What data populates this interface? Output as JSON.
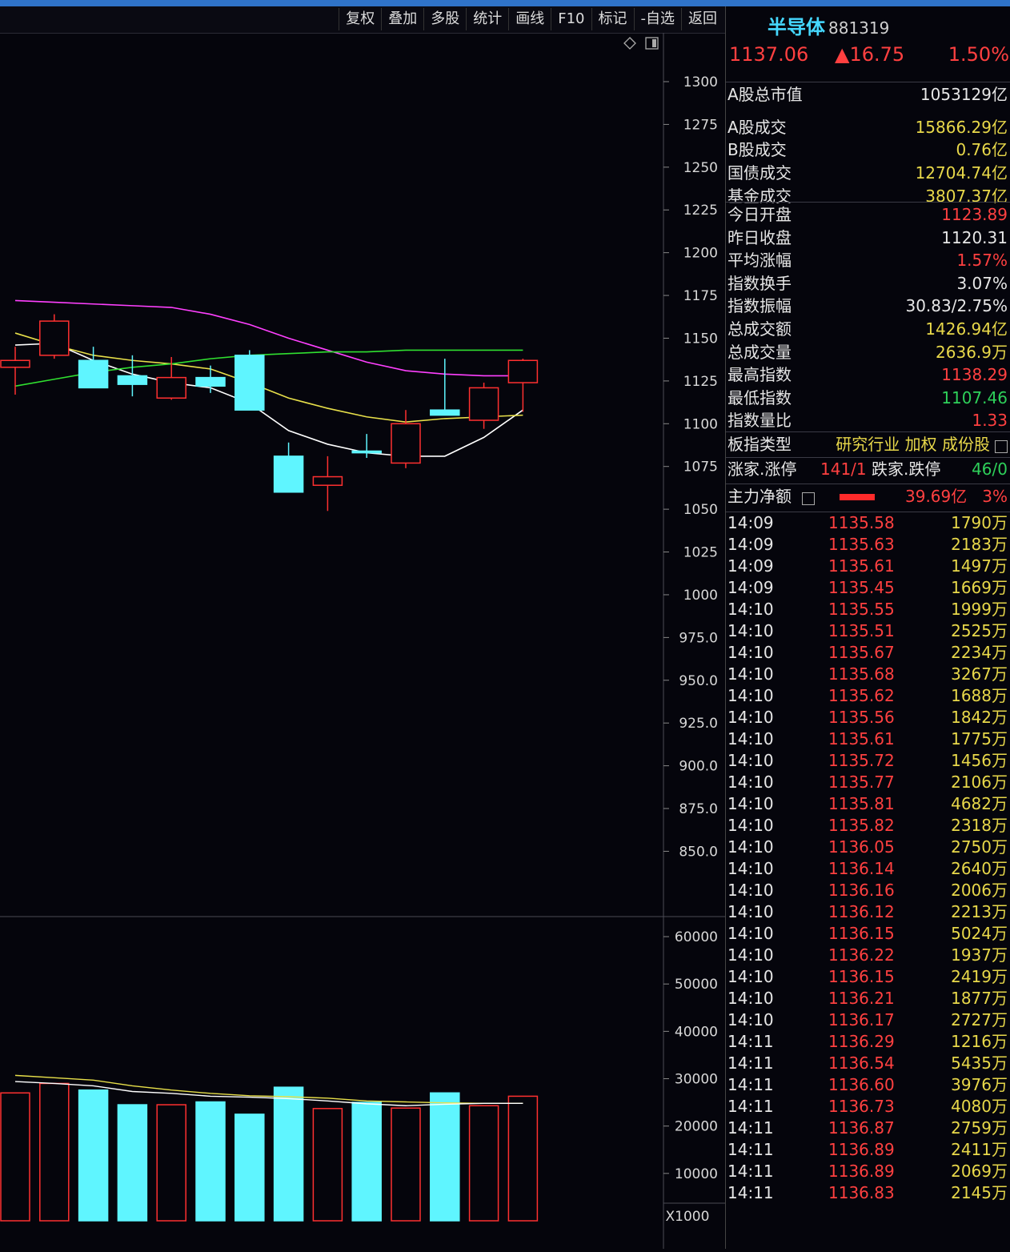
{
  "toolbar": {
    "items": [
      "复权",
      "叠加",
      "多股",
      "统计",
      "画线",
      "F10",
      "标记",
      "-自选",
      "返回"
    ]
  },
  "header": {
    "name": "半导体",
    "code": "881319",
    "price": "1137.06",
    "change": "▲16.75",
    "change_pct": "1.50%"
  },
  "market": [
    {
      "label": "A股总市值",
      "value": "1053129亿",
      "color": "#e6e6e6"
    },
    {
      "label": "A股成交",
      "value": "15866.29亿",
      "color": "#e8d84a"
    },
    {
      "label": "B股成交",
      "value": "0.76亿",
      "color": "#e8d84a"
    },
    {
      "label": "国债成交",
      "value": "12704.74亿",
      "color": "#e8d84a"
    },
    {
      "label": "基金成交",
      "value": "3807.37亿",
      "color": "#e8d84a"
    }
  ],
  "stats": [
    {
      "label": "今日开盘",
      "value": "1123.89",
      "color": "#ff4040"
    },
    {
      "label": "昨日收盘",
      "value": "1120.31",
      "color": "#e6e6e6"
    },
    {
      "label": "平均涨幅",
      "value": "1.57%",
      "color": "#ff4040"
    },
    {
      "label": "指数换手",
      "value": "3.07%",
      "color": "#e6e6e6"
    },
    {
      "label": "指数振幅",
      "value": "30.83/2.75%",
      "color": "#e6e6e6"
    },
    {
      "label": "总成交额",
      "value": "1426.94亿",
      "color": "#e8d84a"
    },
    {
      "label": "总成交量",
      "value": "2636.9万",
      "color": "#e8d84a"
    },
    {
      "label": "最高指数",
      "value": "1138.29",
      "color": "#ff4040"
    },
    {
      "label": "最低指数",
      "value": "1107.46",
      "color": "#2ed05a"
    },
    {
      "label": "指数量比",
      "value": "1.33",
      "color": "#ff4040"
    }
  ],
  "board": {
    "label": "板指类型",
    "value": "研究行业 加权 成份股"
  },
  "updown": {
    "up_label": "涨家.涨停",
    "up_value": "141/1",
    "down_label": "跌家.跌停",
    "down_value": "46/0"
  },
  "mainforce": {
    "label": "主力净额",
    "value": "39.69亿",
    "pct": "3%"
  },
  "ticks": [
    {
      "t": "14:09",
      "p": "1135.58",
      "v": "1790万"
    },
    {
      "t": "14:09",
      "p": "1135.63",
      "v": "2183万"
    },
    {
      "t": "14:09",
      "p": "1135.61",
      "v": "1497万"
    },
    {
      "t": "14:09",
      "p": "1135.45",
      "v": "1669万"
    },
    {
      "t": "14:10",
      "p": "1135.55",
      "v": "1999万"
    },
    {
      "t": "14:10",
      "p": "1135.51",
      "v": "2525万"
    },
    {
      "t": "14:10",
      "p": "1135.67",
      "v": "2234万"
    },
    {
      "t": "14:10",
      "p": "1135.68",
      "v": "3267万"
    },
    {
      "t": "14:10",
      "p": "1135.62",
      "v": "1688万"
    },
    {
      "t": "14:10",
      "p": "1135.56",
      "v": "1842万"
    },
    {
      "t": "14:10",
      "p": "1135.61",
      "v": "1775万"
    },
    {
      "t": "14:10",
      "p": "1135.72",
      "v": "1456万"
    },
    {
      "t": "14:10",
      "p": "1135.77",
      "v": "2106万"
    },
    {
      "t": "14:10",
      "p": "1135.81",
      "v": "4682万"
    },
    {
      "t": "14:10",
      "p": "1135.82",
      "v": "2318万"
    },
    {
      "t": "14:10",
      "p": "1136.05",
      "v": "2750万"
    },
    {
      "t": "14:10",
      "p": "1136.14",
      "v": "2640万"
    },
    {
      "t": "14:10",
      "p": "1136.16",
      "v": "2006万"
    },
    {
      "t": "14:10",
      "p": "1136.12",
      "v": "2213万"
    },
    {
      "t": "14:10",
      "p": "1136.15",
      "v": "5024万"
    },
    {
      "t": "14:10",
      "p": "1136.22",
      "v": "1937万"
    },
    {
      "t": "14:10",
      "p": "1136.15",
      "v": "2419万"
    },
    {
      "t": "14:10",
      "p": "1136.21",
      "v": "1877万"
    },
    {
      "t": "14:10",
      "p": "1136.17",
      "v": "2727万"
    },
    {
      "t": "14:11",
      "p": "1136.29",
      "v": "1216万"
    },
    {
      "t": "14:11",
      "p": "1136.54",
      "v": "5435万"
    },
    {
      "t": "14:11",
      "p": "1136.60",
      "v": "3976万"
    },
    {
      "t": "14:11",
      "p": "1136.73",
      "v": "4080万"
    },
    {
      "t": "14:11",
      "p": "1136.87",
      "v": "2759万"
    },
    {
      "t": "14:11",
      "p": "1136.89",
      "v": "2411万"
    },
    {
      "t": "14:11",
      "p": "1136.89",
      "v": "2069万"
    },
    {
      "t": "14:11",
      "p": "1136.83",
      "v": "2145万"
    }
  ],
  "chart_data": {
    "type": "candlestick",
    "price_axis": {
      "ticks": [
        "1300",
        "1275",
        "1250",
        "1225",
        "1200",
        "1175",
        "1150",
        "1125",
        "1100",
        "1075",
        "1050",
        "1025",
        "1000",
        "975.0",
        "950.0",
        "925.0",
        "900.0",
        "875.0",
        "850.0"
      ],
      "range": [
        830,
        1320
      ]
    },
    "volume_axis": {
      "ticks": [
        "60000",
        "50000",
        "40000",
        "30000",
        "20000",
        "10000"
      ],
      "unit": "X1000",
      "range": [
        0,
        65000
      ]
    },
    "up_color": "#ff3030",
    "down_color": "#5ff5ff",
    "candles": [
      {
        "open": 1133,
        "close": 1137,
        "high": 1145,
        "low": 1117
      },
      {
        "open": 1140,
        "close": 1160,
        "high": 1164,
        "low": 1138
      },
      {
        "open": 1137,
        "close": 1121,
        "high": 1145,
        "low": 1121
      },
      {
        "open": 1128,
        "close": 1123,
        "high": 1140,
        "low": 1116
      },
      {
        "open": 1115,
        "close": 1127,
        "high": 1139,
        "low": 1114
      },
      {
        "open": 1127,
        "close": 1122,
        "high": 1134,
        "low": 1118
      },
      {
        "open": 1140,
        "close": 1108,
        "high": 1143,
        "low": 1108
      },
      {
        "open": 1081,
        "close": 1060,
        "high": 1089,
        "low": 1060
      },
      {
        "open": 1064,
        "close": 1069,
        "high": 1081,
        "low": 1049
      },
      {
        "open": 1084,
        "close": 1083,
        "high": 1094,
        "low": 1080
      },
      {
        "open": 1077,
        "close": 1100,
        "high": 1108,
        "low": 1074
      },
      {
        "open": 1108,
        "close": 1105,
        "high": 1138,
        "low": 1105
      },
      {
        "open": 1102,
        "close": 1121,
        "high": 1124,
        "low": 1097
      },
      {
        "open": 1124,
        "close": 1137,
        "high": 1138,
        "low": 1107
      }
    ],
    "ma_lines": [
      {
        "color": "#ffffff",
        "values": [
          1146,
          1147,
          1137,
          1129,
          1124,
          1121,
          1112,
          1096,
          1088,
          1083,
          1081,
          1081,
          1092,
          1108
        ]
      },
      {
        "color": "#e8e04a",
        "values": [
          1153,
          1146,
          1140,
          1137,
          1135,
          1132,
          1124,
          1115,
          1109,
          1104,
          1101,
          1103,
          1104,
          1105
        ]
      },
      {
        "color": "#ff40ff",
        "values": [
          1172,
          1171,
          1170,
          1169,
          1168,
          1164,
          1158,
          1150,
          1143,
          1136,
          1131,
          1129,
          1128,
          1128
        ]
      },
      {
        "color": "#30e030",
        "values": [
          1122,
          1126,
          1130,
          1133,
          1135,
          1138,
          1140,
          1141,
          1142,
          1142,
          1143,
          1143,
          1143,
          1143
        ]
      }
    ],
    "volume": [
      27000,
      29000,
      27600,
      24500,
      24500,
      25100,
      22500,
      28200,
      23700,
      25000,
      23800,
      27000,
      24300,
      26300
    ],
    "volume_ma": [
      {
        "color": "#e8e04a",
        "values": [
          30700,
          30200,
          29700,
          28500,
          27600,
          26900,
          26400,
          26200,
          25900,
          25300,
          25100,
          24900,
          24800,
          24800
        ]
      },
      {
        "color": "#ffffff",
        "values": [
          29400,
          29000,
          28500,
          27300,
          26900,
          26300,
          26100,
          25800,
          25300,
          24700,
          24300,
          24600,
          24800,
          24800
        ]
      }
    ]
  }
}
